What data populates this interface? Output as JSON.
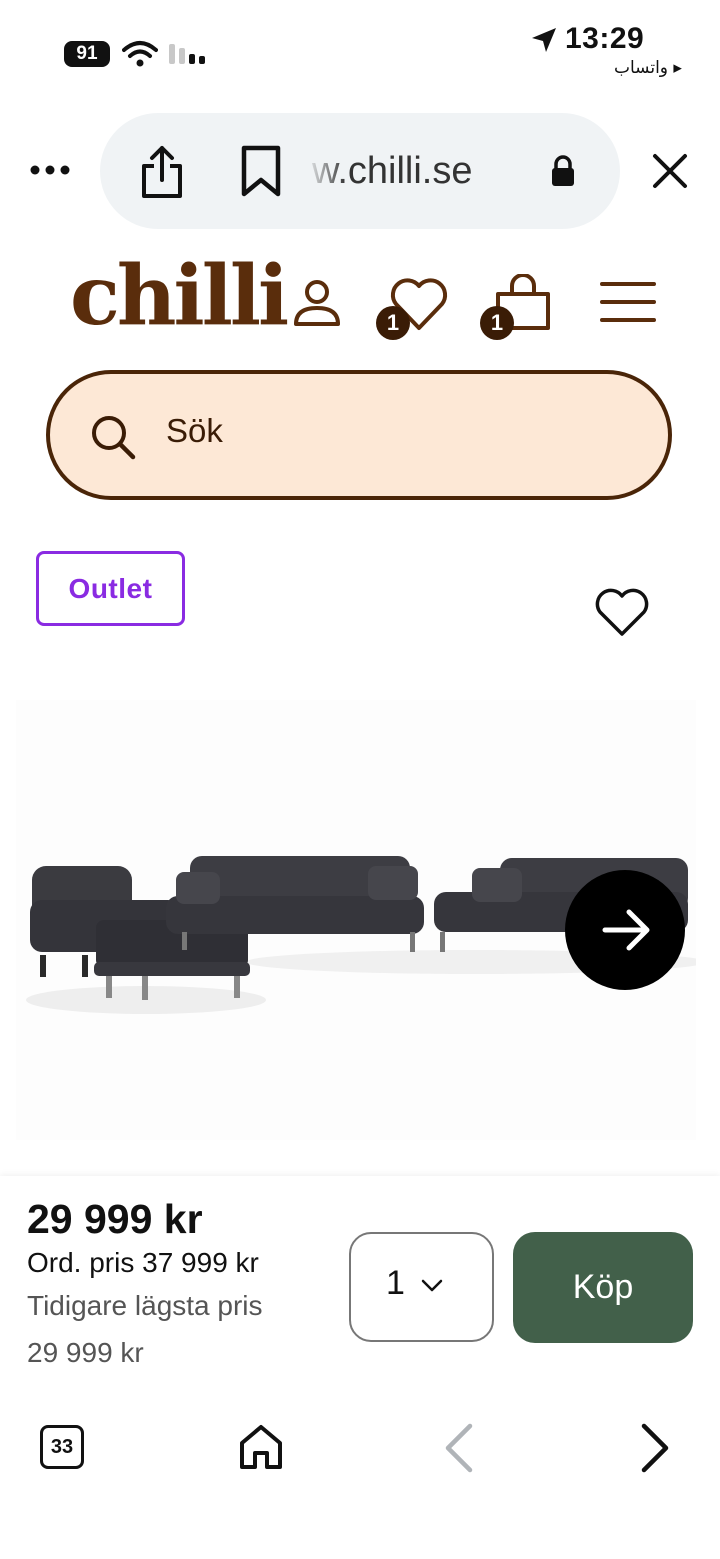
{
  "status_bar": {
    "time": "13:29",
    "back_app": "واتساب ▸",
    "battery": "91"
  },
  "browser": {
    "url": "w.chilli.se",
    "tab_count": "33"
  },
  "header": {
    "logo": "chilli",
    "wishlist_count": "1",
    "cart_count": "1"
  },
  "search": {
    "placeholder": "Sök"
  },
  "product": {
    "badge": "Outlet",
    "price": "29 999 kr",
    "ordinary_price": "Ord. pris 37 999 kr",
    "lowest_price_label": "Tidigare lägsta pris",
    "lowest_price_value": "29 999 kr",
    "quantity": "1",
    "buy_label": "Köp"
  },
  "colors": {
    "brand_brown": "#5a2d0c",
    "search_bg": "#fde8d6",
    "outlet_purple": "#8a2be2",
    "buy_green": "#42604a"
  }
}
